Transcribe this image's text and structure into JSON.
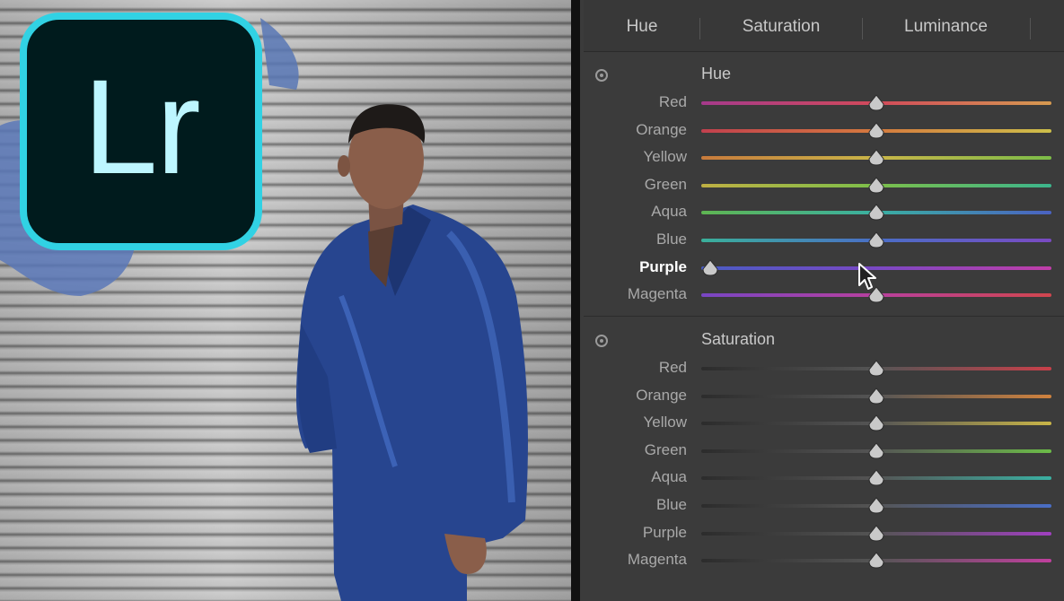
{
  "logo": {
    "text": "Lr",
    "border_color": "#31d2e4",
    "bg_color": "#001b1d",
    "text_color": "#bdf6ff"
  },
  "tabs": [
    {
      "label": "Hue"
    },
    {
      "label": "Saturation"
    },
    {
      "label": "Luminance"
    }
  ],
  "hue": {
    "title": "Hue",
    "rows": [
      {
        "label": "Red",
        "value": 0,
        "colors": [
          "#a63a8c",
          "#d14a5a",
          "#d69a50"
        ]
      },
      {
        "label": "Orange",
        "value": 0,
        "colors": [
          "#c2404e",
          "#d57a3e",
          "#cdbf4a"
        ]
      },
      {
        "label": "Yellow",
        "value": 0,
        "colors": [
          "#c87b3c",
          "#c9b548",
          "#7cbc48"
        ]
      },
      {
        "label": "Green",
        "value": 0,
        "colors": [
          "#bfb043",
          "#7cbf4a",
          "#3cb58c"
        ]
      },
      {
        "label": "Aqua",
        "value": 0,
        "colors": [
          "#5fb552",
          "#3ab0a2",
          "#4a62c2"
        ]
      },
      {
        "label": "Blue",
        "value": 0,
        "colors": [
          "#3ab09a",
          "#4a6ec6",
          "#7a4ac2"
        ]
      },
      {
        "label": "Purple",
        "value": -100,
        "colors": [
          "#4a5cc4",
          "#7a48c4",
          "#c03ea8"
        ],
        "active": true
      },
      {
        "label": "Magenta",
        "value": 0,
        "colors": [
          "#7846c4",
          "#b8409e",
          "#d0464e"
        ]
      }
    ]
  },
  "saturation": {
    "title": "Saturation",
    "rows": [
      {
        "label": "Red",
        "value": 0,
        "colors": [
          "#2c2c2c",
          "#555555",
          "#c8404a"
        ]
      },
      {
        "label": "Orange",
        "value": 0,
        "colors": [
          "#2c2c2c",
          "#555555",
          "#d0823e"
        ]
      },
      {
        "label": "Yellow",
        "value": 0,
        "colors": [
          "#2c2c2c",
          "#555555",
          "#c9b548"
        ]
      },
      {
        "label": "Green",
        "value": 0,
        "colors": [
          "#2c2c2c",
          "#555555",
          "#6cbc48"
        ]
      },
      {
        "label": "Aqua",
        "value": 0,
        "colors": [
          "#2c2c2c",
          "#555555",
          "#3ab0a2"
        ]
      },
      {
        "label": "Blue",
        "value": 0,
        "colors": [
          "#2c2c2c",
          "#555555",
          "#4a6ec6"
        ]
      },
      {
        "label": "Purple",
        "value": 0,
        "colors": [
          "#2c2c2c",
          "#555555",
          "#a040c0"
        ]
      },
      {
        "label": "Magenta",
        "value": 0,
        "colors": [
          "#2c2c2c",
          "#555555",
          "#c0409e"
        ]
      }
    ]
  },
  "colors": {
    "panel_bg": "#3b3b3b",
    "label": "#a9a9a9",
    "label_active": "#ffffff",
    "logo_accent": "#31d2e4"
  }
}
